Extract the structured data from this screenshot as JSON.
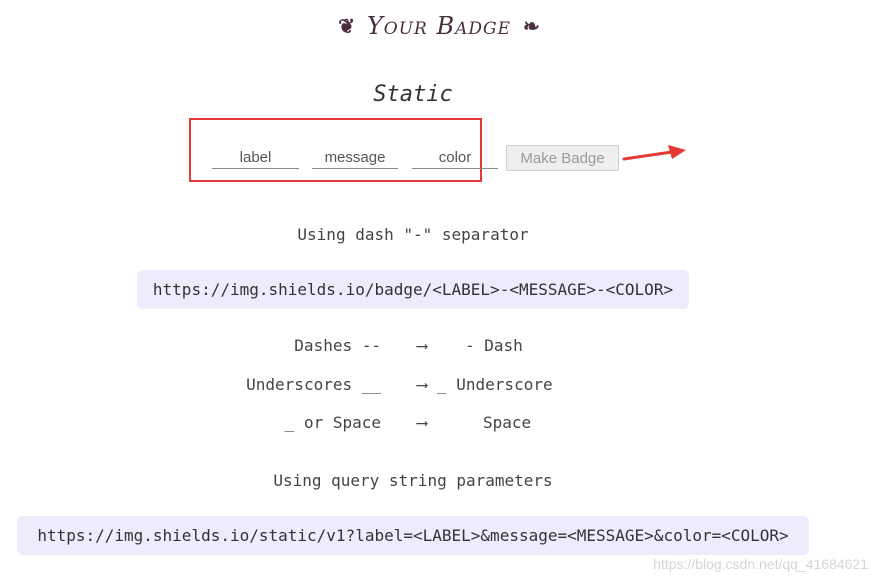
{
  "header": {
    "left_ornament": "❦",
    "title": "Your Badge",
    "right_ornament": "❧"
  },
  "static_section": {
    "title": "Static",
    "label_placeholder": "label",
    "message_placeholder": "message",
    "color_placeholder": "color",
    "button_label": "Make Badge"
  },
  "dash_section": {
    "heading": "Using dash \"-\" separator",
    "url": "https://img.shields.io/badge/<LABEL>-<MESSAGE>-<COLOR>",
    "rows": [
      {
        "left": "Dashes --",
        "arrow": "⟶",
        "right": "- Dash"
      },
      {
        "left": "Underscores __",
        "arrow": "⟶",
        "right": "_ Underscore"
      },
      {
        "left": "_ or Space",
        "arrow": "⟶",
        "right": "Space"
      }
    ]
  },
  "query_section": {
    "heading": "Using query string parameters",
    "url": "https://img.shields.io/static/v1?label=<LABEL>&message=<MESSAGE>&color=<COLOR>"
  },
  "watermark": "https://blog.csdn.net/qq_41684621",
  "colors": {
    "highlight": "#e53935",
    "code_background": "#ececfc",
    "brand": "#4b2e3f"
  }
}
